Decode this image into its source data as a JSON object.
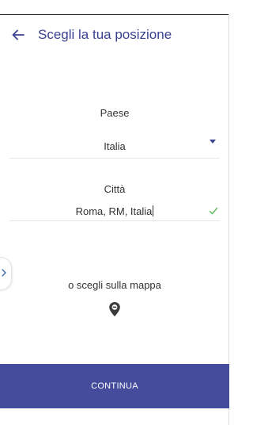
{
  "header": {
    "title": "Scegli la tua posizione",
    "back_icon": "arrow-left-icon"
  },
  "form": {
    "country": {
      "label": "Paese",
      "value": "Italia",
      "icon": "dropdown-triangle-icon"
    },
    "city": {
      "label": "Città",
      "value": "Roma, RM, Italia",
      "icon": "check-icon"
    }
  },
  "map": {
    "link_text": "o scegli sulla mappa",
    "icon": "map-pin-icon"
  },
  "side_handle_icon": "chevron-right-icon",
  "footer": {
    "continue_label": "CONTINUA"
  },
  "colors": {
    "accent": "#3a4290",
    "button": "#454c9c",
    "check": "#5cb85c"
  }
}
